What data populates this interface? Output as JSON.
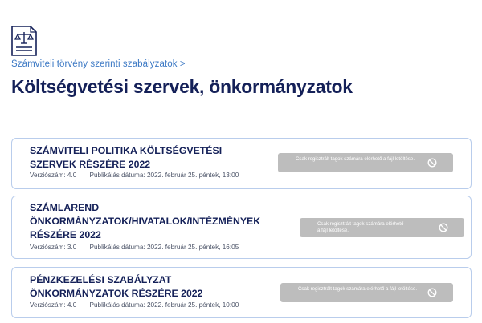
{
  "header": {
    "icon": "document-scale-icon",
    "breadcrumb": "Számviteli törvény szerinti szabályzatok >",
    "title": "Költségvetési szervek, önkormányzatok"
  },
  "labels": {
    "version_prefix": "Verziószám:",
    "published_prefix": "Publikálás dátuma:"
  },
  "documents": [
    {
      "title": "SZÁMVITELI POLITIKA KÖLTSÉGVETÉSI SZERVEK RÉSZÉRE 2022",
      "version": "Verziószám: 4.0",
      "published": "Publikálás dátuma: 2022. február 25. péntek, 13:00",
      "download_notice": "Csak regisztrált tagok számára elérhető a fájl letöltése.",
      "download_icon": "no-entry-icon"
    },
    {
      "title": "SZÁMLAREND ÖNKORMÁNYZATOK/HIVATALOK/INTÉZMÉNYEK RÉSZÉRE 2022",
      "version": "Verziószám: 3.0",
      "published": "Publikálás dátuma: 2022. február 25. péntek, 16:05",
      "download_notice": "Csak regisztrált tagok számára elérhető a fájl letöltése.",
      "download_icon": "no-entry-icon"
    },
    {
      "title": "PÉNZKEZELÉSI SZABÁLYZAT ÖNKORMÁNYZATOK RÉSZÉRE 2022",
      "version": "Verziószám: 4.0",
      "published": "Publikálás dátuma: 2022. február 25. péntek, 10:00",
      "download_notice": "Csak regisztrált tagok számára elérhető a fájl letöltése.",
      "download_icon": "no-entry-icon"
    }
  ],
  "colors": {
    "title": "#142058",
    "breadcrumb": "#3b78c4",
    "card_border": "#b9cdec",
    "disabled_button": "#bdbdbd"
  }
}
